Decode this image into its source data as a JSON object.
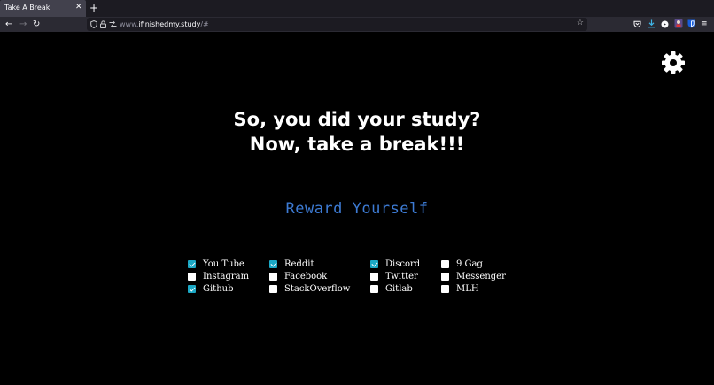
{
  "browser": {
    "tab_title": "Take A Break",
    "tab_close": "✕",
    "new_tab": "+",
    "back": "←",
    "forward": "→",
    "reload": "↻",
    "url_prefix": "www.",
    "url_domain": "ifinishedmy.study",
    "url_suffix": "/#",
    "star": "☆",
    "menu": "≡"
  },
  "page": {
    "heading_line1": "So, you did your study?",
    "heading_line2": "Now, take a break!!!",
    "reward_link": "Reward Yourself",
    "accent_color": "#3d7bd4",
    "checkbox_color": "#1ba8c5"
  },
  "sites": [
    {
      "label": "You Tube",
      "checked": true
    },
    {
      "label": "Instagram",
      "checked": false
    },
    {
      "label": "Github",
      "checked": true
    },
    {
      "label": "Reddit",
      "checked": true
    },
    {
      "label": "Facebook",
      "checked": false
    },
    {
      "label": "StackOverflow",
      "checked": false
    },
    {
      "label": "Discord",
      "checked": true
    },
    {
      "label": "Twitter",
      "checked": false
    },
    {
      "label": "Gitlab",
      "checked": false
    },
    {
      "label": "9 Gag",
      "checked": false
    },
    {
      "label": "Messenger",
      "checked": false
    },
    {
      "label": "MLH",
      "checked": false
    }
  ]
}
